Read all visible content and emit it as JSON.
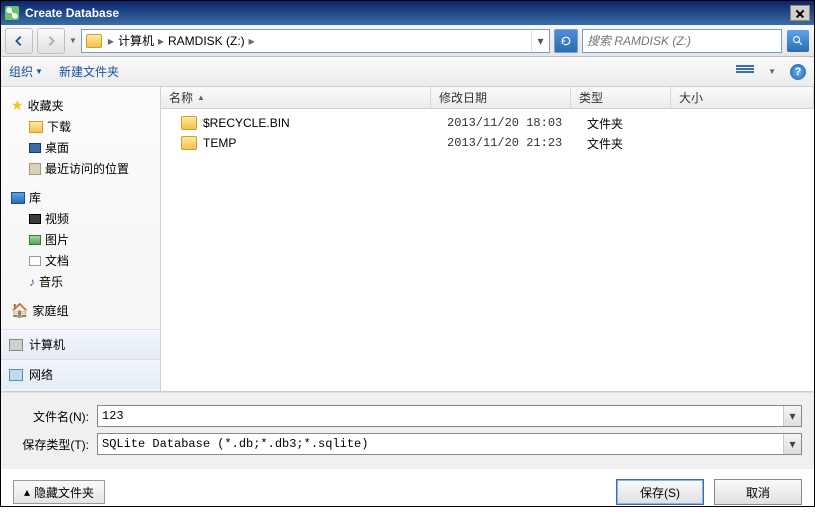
{
  "window": {
    "title": "Create Database"
  },
  "nav": {
    "crumbs": [
      "计算机",
      "RAMDISK (Z:)"
    ],
    "search_placeholder": "搜索 RAMDISK (Z:)"
  },
  "toolbar": {
    "organize": "组织",
    "new_folder": "新建文件夹"
  },
  "sidebar": {
    "favorites": {
      "label": "收藏夹",
      "items": [
        "下载",
        "桌面",
        "最近访问的位置"
      ]
    },
    "libraries": {
      "label": "库",
      "items": [
        "视频",
        "图片",
        "文档",
        "音乐"
      ]
    },
    "homegroup": "家庭组",
    "computer": "计算机",
    "network": "网络"
  },
  "columns": {
    "name": "名称",
    "date": "修改日期",
    "type": "类型",
    "size": "大小"
  },
  "files": [
    {
      "name": "$RECYCLE.BIN",
      "date": "2013/11/20 18:03",
      "type": "文件夹"
    },
    {
      "name": "TEMP",
      "date": "2013/11/20 21:23",
      "type": "文件夹"
    }
  ],
  "fields": {
    "filename_label": "文件名(N):",
    "filename_value": "123",
    "filetype_label": "保存类型(T):",
    "filetype_value": "SQLite Database (*.db;*.db3;*.sqlite)"
  },
  "footer": {
    "hide_folders": "隐藏文件夹",
    "save": "保存(S)",
    "cancel": "取消"
  }
}
